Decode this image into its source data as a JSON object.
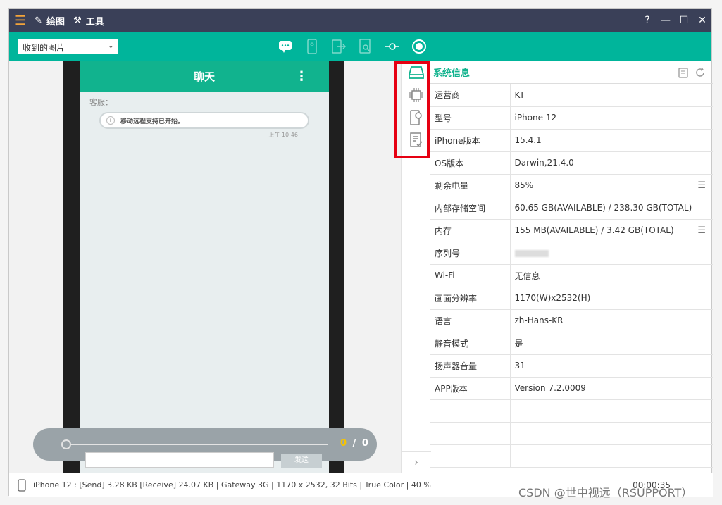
{
  "titlebar": {
    "draw_label": "绘图",
    "tools_label": "工具",
    "help": "?"
  },
  "toolbar": {
    "select_value": "收到的图片"
  },
  "chat": {
    "title": "聊天",
    "agent_label": "客服：",
    "message": "移动远程支持已开始。",
    "time": "上午 10:46",
    "send_label": "发送"
  },
  "player": {
    "current": "0",
    "separator": "/",
    "total": "0"
  },
  "sysinfo": {
    "title": "系统信息",
    "rows": [
      {
        "key": "运营商",
        "value": "KT"
      },
      {
        "key": "型号",
        "value": "iPhone 12"
      },
      {
        "key": "iPhone版本",
        "value": "15.4.1"
      },
      {
        "key": "OS版本",
        "value": "Darwin,21.4.0"
      },
      {
        "key": "剩余电量",
        "value": "85%"
      },
      {
        "key": "内部存储空间",
        "value": "60.65 GB(AVAILABLE) / 238.30 GB(TOTAL)"
      },
      {
        "key": "内存",
        "value": "155 MB(AVAILABLE) / 3.42 GB(TOTAL)"
      },
      {
        "key": "序列号",
        "value": ""
      },
      {
        "key": "Wi-Fi",
        "value": "无信息"
      },
      {
        "key": "画面分辨率",
        "value": "1170(W)x2532(H)"
      },
      {
        "key": "语言",
        "value": "zh-Hans-KR"
      },
      {
        "key": "静音模式",
        "value": "是"
      },
      {
        "key": "扬声器音量",
        "value": "31"
      },
      {
        "key": "APP版本",
        "value": "Version 7.2.0009"
      }
    ]
  },
  "status": {
    "text": "iPhone 12 : [Send]  3.28 KB   [Receive]  24.07 KB | Gateway 3G | 1170 x 2532, 32 Bits | True Color | 40 %",
    "timer": "00:00:35"
  },
  "watermark": "CSDN @世中视远（RSUPPORT）",
  "colors": {
    "accent": "#00b59b",
    "titlebar": "#3a4058",
    "highlight": "#e60012"
  }
}
